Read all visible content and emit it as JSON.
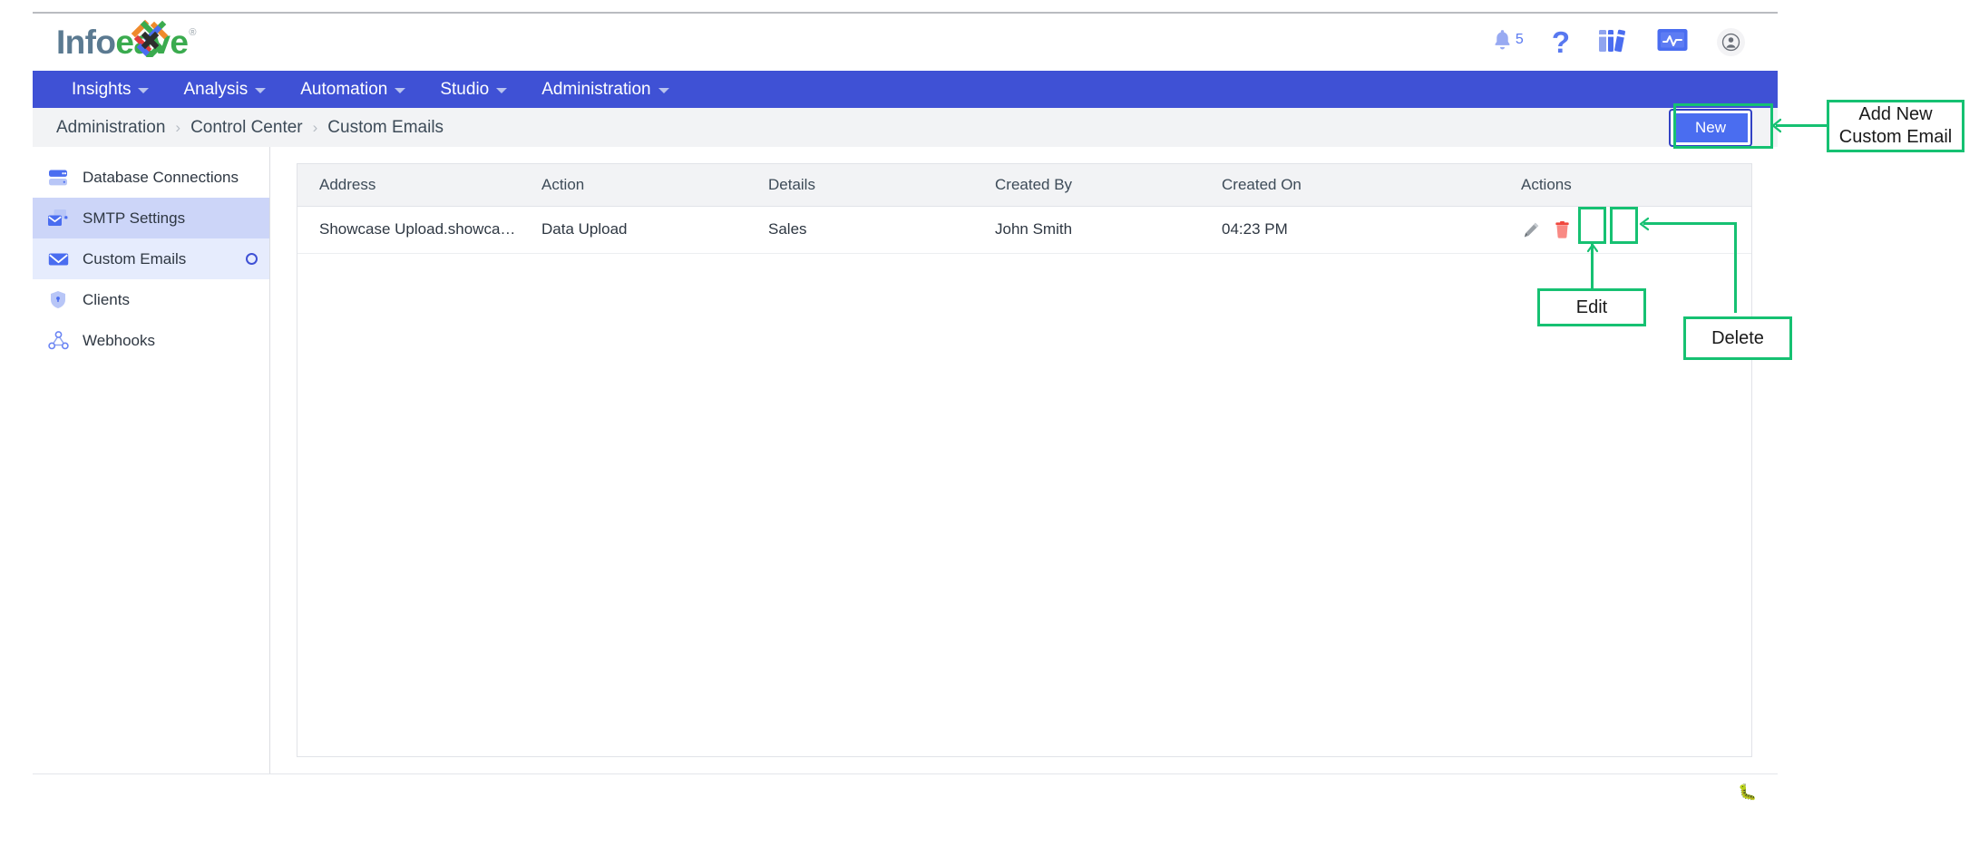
{
  "brand": {
    "name_part1": "Info",
    "name_part2": "eave",
    "registered": "®",
    "primary_color": "#3f51d5",
    "accent_color": "#4a6df0",
    "annotation_color": "#16c172"
  },
  "topbar": {
    "icons": [
      {
        "name": "notifications-bell-icon",
        "badge": "5"
      },
      {
        "name": "help-question-icon"
      },
      {
        "name": "library-books-icon"
      },
      {
        "name": "monitor-activity-icon"
      },
      {
        "name": "user-account-icon"
      }
    ]
  },
  "nav": {
    "items": [
      {
        "label": "Insights",
        "has_caret": true
      },
      {
        "label": "Analysis",
        "has_caret": true
      },
      {
        "label": "Automation",
        "has_caret": true
      },
      {
        "label": "Studio",
        "has_caret": true
      },
      {
        "label": "Administration",
        "has_caret": true
      }
    ]
  },
  "breadcrumb": {
    "separator": "›",
    "items": [
      "Administration",
      "Control Center",
      "Custom Emails"
    ]
  },
  "toolbar": {
    "new_label": "New"
  },
  "sidebar": {
    "items": [
      {
        "label": "Database Connections",
        "icon": "database-icon",
        "state": "default",
        "ring": false
      },
      {
        "label": "SMTP Settings",
        "icon": "smtp-mail-icon",
        "state": "active-dark",
        "ring": false
      },
      {
        "label": "Custom Emails",
        "icon": "envelope-icon",
        "state": "active-light",
        "ring": true
      },
      {
        "label": "Clients",
        "icon": "shield-icon",
        "state": "default",
        "ring": false
      },
      {
        "label": "Webhooks",
        "icon": "webhook-node-icon",
        "state": "default",
        "ring": false
      }
    ]
  },
  "table": {
    "columns": [
      "Address",
      "Action",
      "Details",
      "Created By",
      "Created On",
      "Actions"
    ],
    "rows": [
      {
        "address": "Showcase Upload.showcase@i…",
        "action": "Data Upload",
        "details": "Sales",
        "created_by": "John Smith",
        "created_on": "04:23 PM",
        "actions": [
          "edit-pencil-icon",
          "delete-trash-icon"
        ]
      }
    ]
  },
  "footer": {
    "bug_icon": "bug-icon"
  },
  "annotations": [
    {
      "id": "add-new-custom-email",
      "text": "Add New\nCustom Email",
      "line1": "Add New",
      "line2": "Custom Email"
    },
    {
      "id": "edit",
      "text": "Edit"
    },
    {
      "id": "delete",
      "text": "Delete"
    }
  ]
}
